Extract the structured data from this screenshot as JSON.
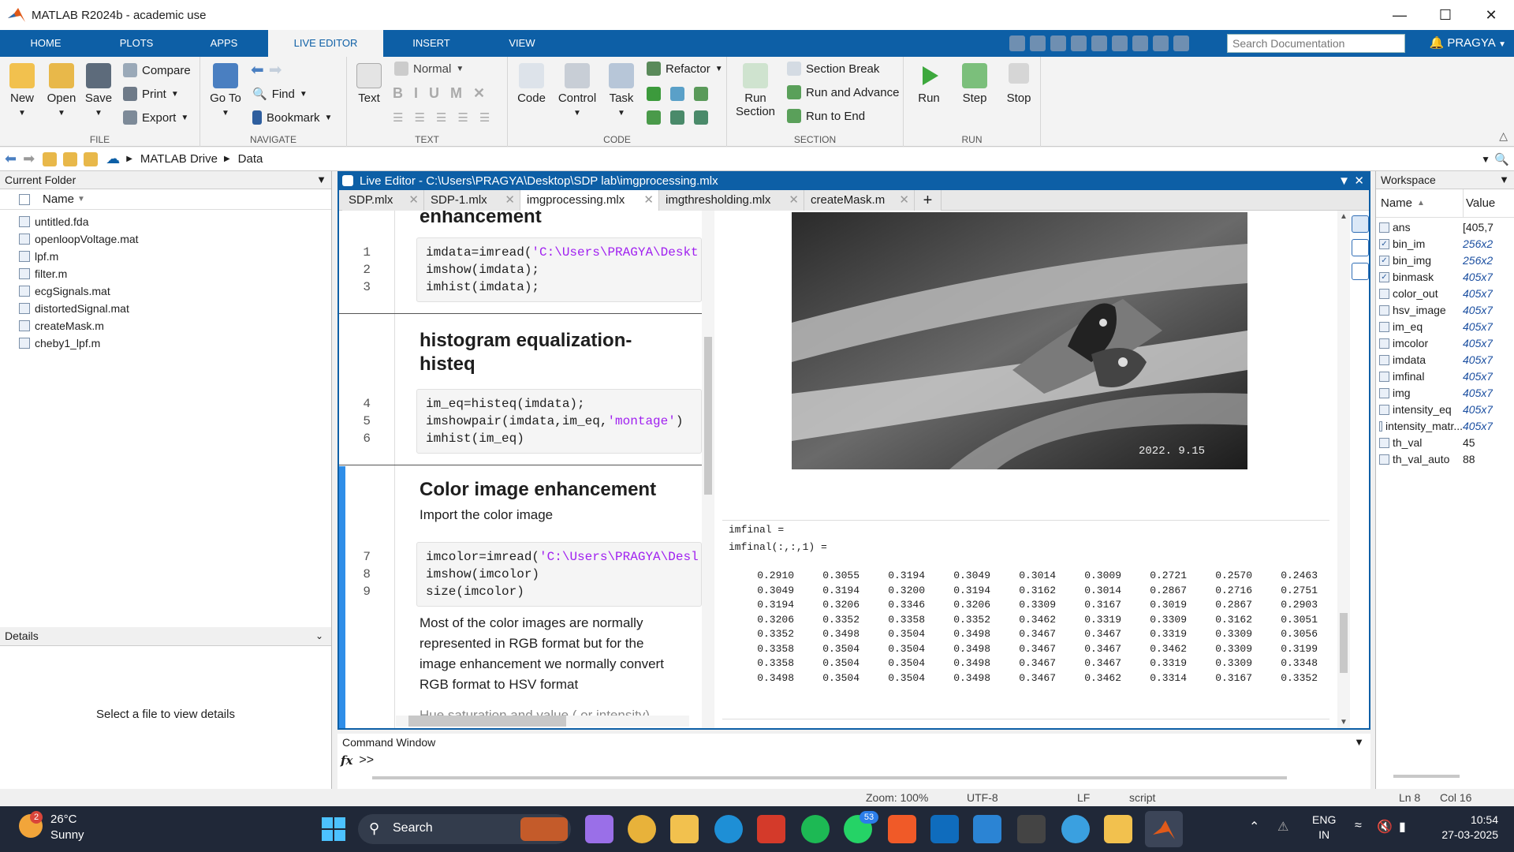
{
  "title": "MATLAB R2024b - academic use",
  "tabs": [
    "HOME",
    "PLOTS",
    "APPS",
    "LIVE EDITOR",
    "INSERT",
    "VIEW"
  ],
  "search_placeholder": "Search Documentation",
  "user": "PRAGYA",
  "ribbon": {
    "file": {
      "label": "FILE",
      "new": "New",
      "open": "Open",
      "save": "Save",
      "compare": "Compare",
      "print": "Print",
      "export": "Export"
    },
    "navigate": {
      "label": "NAVIGATE",
      "goto": "Go To",
      "find": "Find",
      "bookmark": "Bookmark"
    },
    "text": {
      "label": "TEXT",
      "text": "Text",
      "style": "Normal"
    },
    "code": {
      "label": "CODE",
      "code": "Code",
      "control": "Control",
      "task": "Task",
      "refactor": "Refactor"
    },
    "section": {
      "label": "SECTION",
      "run_section": "Run Section",
      "section_break": "Section Break",
      "run_advance": "Run and Advance",
      "run_end": "Run to End"
    },
    "run": {
      "label": "RUN",
      "run": "Run",
      "step": "Step",
      "stop": "Stop"
    }
  },
  "address": [
    "MATLAB Drive",
    "Data"
  ],
  "current_folder": {
    "title": "Current Folder",
    "col_name": "Name",
    "files": [
      "untitled.fda",
      "openloopVoltage.mat",
      "lpf.m",
      "filter.m",
      "ecgSignals.mat",
      "distortedSignal.mat",
      "createMask.m",
      "cheby1_lpf.m"
    ]
  },
  "details": {
    "title": "Details",
    "empty": "Select a file to view details"
  },
  "editor": {
    "title": "Live Editor - C:\\Users\\PRAGYA\\Desktop\\SDP lab\\imgprocessing.mlx",
    "tabs": [
      "SDP.mlx",
      "SDP-1.mlx",
      "imgprocessing.mlx",
      "imgthresholding.mlx",
      "createMask.m"
    ],
    "heading1": "enhancement",
    "block1": [
      {
        "n": "1",
        "pre": "imdata=imread(",
        "str": "'C:\\Users\\PRAGYA\\Deskt",
        "post": ""
      },
      {
        "n": "2",
        "pre": "imshow(imdata);",
        "str": "",
        "post": ""
      },
      {
        "n": "3",
        "pre": "imhist(imdata);",
        "str": "",
        "post": ""
      }
    ],
    "heading2a": "histogram equalization-",
    "heading2b": "histeq",
    "block2": [
      {
        "n": "4",
        "pre": "im_eq=histeq(imdata);",
        "str": "",
        "post": ""
      },
      {
        "n": "5",
        "pre": "imshowpair(imdata,im_eq,",
        "str": "'montage'",
        "post": ")"
      },
      {
        "n": "6",
        "pre": "imhist(im_eq)",
        "str": "",
        "post": ""
      }
    ],
    "heading3": "Color image enhancement",
    "text3": "Import the color image",
    "block3": [
      {
        "n": "7",
        "pre": "imcolor=imread(",
        "str": "'C:\\Users\\PRAGYA\\Desl",
        "post": ""
      },
      {
        "n": "8",
        "pre": "imshow(imcolor)",
        "str": "",
        "post": ""
      },
      {
        "n": "9",
        "pre": "size(imcolor)",
        "str": "",
        "post": ""
      }
    ],
    "para": [
      "Most of the color images are normally",
      "represented in RGB format but for the",
      "image enhancement we normally convert",
      "RGB format to HSV format"
    ],
    "para_cut": "Hue saturation and value ( or intensity)",
    "image_stamp": "2022. 9.15",
    "out1": "imfinal =",
    "out2": "imfinal(:,:,1) =",
    "matrix": [
      [
        "0.2910",
        "0.3055",
        "0.3194",
        "0.3049",
        "0.3014",
        "0.3009",
        "0.2721",
        "0.2570",
        "0.2463"
      ],
      [
        "0.3049",
        "0.3194",
        "0.3200",
        "0.3194",
        "0.3162",
        "0.3014",
        "0.2867",
        "0.2716",
        "0.2751"
      ],
      [
        "0.3194",
        "0.3206",
        "0.3346",
        "0.3206",
        "0.3309",
        "0.3167",
        "0.3019",
        "0.2867",
        "0.2903"
      ],
      [
        "0.3206",
        "0.3352",
        "0.3358",
        "0.3352",
        "0.3462",
        "0.3319",
        "0.3309",
        "0.3162",
        "0.3051"
      ],
      [
        "0.3352",
        "0.3498",
        "0.3504",
        "0.3498",
        "0.3467",
        "0.3467",
        "0.3319",
        "0.3309",
        "0.3056"
      ],
      [
        "0.3358",
        "0.3504",
        "0.3504",
        "0.3498",
        "0.3467",
        "0.3467",
        "0.3462",
        "0.3309",
        "0.3199"
      ],
      [
        "0.3358",
        "0.3504",
        "0.3504",
        "0.3498",
        "0.3467",
        "0.3467",
        "0.3319",
        "0.3309",
        "0.3348"
      ],
      [
        "0.3498",
        "0.3504",
        "0.3504",
        "0.3498",
        "0.3467",
        "0.3462",
        "0.3314",
        "0.3167",
        "0.3352"
      ]
    ]
  },
  "workspace": {
    "title": "Workspace",
    "col_name": "Name",
    "col_value": "Value",
    "vars": [
      {
        "name": "ans",
        "value": "[405,7",
        "checked": false,
        "italic": false
      },
      {
        "name": "bin_im",
        "value": "256x2",
        "checked": true,
        "italic": true
      },
      {
        "name": "bin_img",
        "value": "256x2",
        "checked": true,
        "italic": true
      },
      {
        "name": "binmask",
        "value": "405x7",
        "checked": true,
        "italic": true
      },
      {
        "name": "color_out",
        "value": "405x7",
        "checked": false,
        "italic": true
      },
      {
        "name": "hsv_image",
        "value": "405x7",
        "checked": false,
        "italic": true
      },
      {
        "name": "im_eq",
        "value": "405x7",
        "checked": false,
        "italic": true
      },
      {
        "name": "imcolor",
        "value": "405x7",
        "checked": false,
        "italic": true
      },
      {
        "name": "imdata",
        "value": "405x7",
        "checked": false,
        "italic": true
      },
      {
        "name": "imfinal",
        "value": "405x7",
        "checked": false,
        "italic": true
      },
      {
        "name": "img",
        "value": "405x7",
        "checked": false,
        "italic": true
      },
      {
        "name": "intensity_eq",
        "value": "405x7",
        "checked": false,
        "italic": true
      },
      {
        "name": "intensity_matr...",
        "value": "405x7",
        "checked": false,
        "italic": true
      },
      {
        "name": "th_val",
        "value": "45",
        "checked": false,
        "italic": false
      },
      {
        "name": "th_val_auto",
        "value": "88",
        "checked": false,
        "italic": false
      }
    ]
  },
  "command": {
    "title": "Command Window",
    "fx": "fx",
    "prompt": ">>"
  },
  "status": {
    "zoom": "Zoom: 100%",
    "enc": "UTF-8",
    "eol": "LF",
    "type": "script",
    "ln": "Ln 8",
    "col": "Col 16"
  },
  "taskbar": {
    "temp": "26°C",
    "weather": "Sunny",
    "weather_badge": "2",
    "search": "Search",
    "whatsapp_badge": "53",
    "lang1": "ENG",
    "lang2": "IN",
    "time": "10:54",
    "date": "27-03-2025"
  },
  "colors": {
    "accent": "#0d5fa6",
    "string": "#a020f0"
  }
}
